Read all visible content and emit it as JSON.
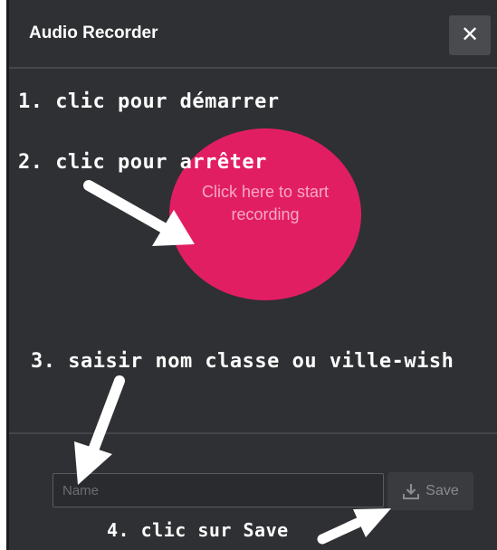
{
  "dialog": {
    "title": "Audio Recorder",
    "close_icon": "close-icon"
  },
  "recorder": {
    "button_text": "Click here to start recording",
    "button_color": "#e21e63"
  },
  "footer": {
    "name_placeholder": "Name",
    "name_value": "",
    "save_label": "Save",
    "save_icon": "download-icon"
  },
  "annotations": {
    "step1": "1. clic pour démarrer",
    "step2": "2. clic pour arrêter",
    "step3": "3. saisir nom classe ou ville-wish",
    "step4": "4. clic sur Save"
  }
}
